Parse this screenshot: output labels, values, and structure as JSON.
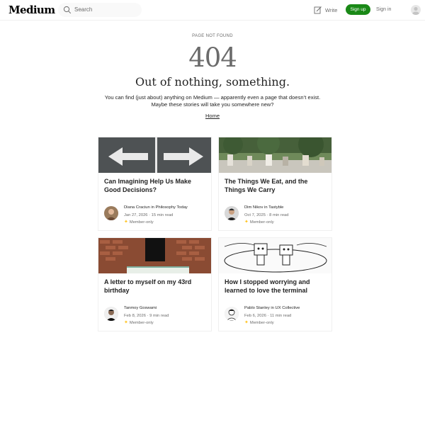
{
  "header": {
    "logo": "Medium",
    "search_placeholder": "Search",
    "write_label": "Write",
    "signup_label": "Sign up",
    "signin_label": "Sign in"
  },
  "notfound": {
    "label": "PAGE NOT FOUND",
    "code": "404",
    "headline": "Out of nothing, something.",
    "description_line1": "You can find (just about) anything on Medium — apparently even a page that doesn’t exist.",
    "description_line2": "Maybe these stories will take you somewhere new?",
    "home_link": "Home"
  },
  "stories": [
    {
      "title": "Can Imagining Help Us Make Good Decisions?",
      "author": "Diana Craciun",
      "publication": "Philosophy Today",
      "date": "Jan 27, 2026 · 15 min read",
      "badge": "Member-only"
    },
    {
      "title": "The Things We Eat, and the Things We Carry",
      "author": "Dim Nikov",
      "publication": "Tastyble",
      "date": "Oct 7, 2025 · 8 min read",
      "badge": "Member-only"
    },
    {
      "title": "A letter to myself on my 43rd birthday",
      "author": "Tanmoy Goswami",
      "publication": "",
      "date": "Feb 8, 2026 · 9 min read",
      "badge": "Member-only"
    },
    {
      "title": "How I stopped worrying and learned to love the terminal",
      "author": "Pablo Stanley",
      "publication": "UX Collective",
      "date": "Feb 6, 2026 · 11 min read",
      "badge": "Member-only"
    }
  ],
  "connector_in": "in",
  "colors": {
    "brand_green": "#1a8917",
    "star": "#ffc017"
  }
}
